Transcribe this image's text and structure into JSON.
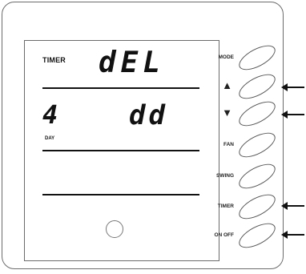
{
  "display": {
    "timer_label": "TIMER",
    "main_readout": "dEL",
    "left_readout": "4",
    "right_readout": "dd",
    "day_label": "DAY"
  },
  "buttons": [
    {
      "id": "mode",
      "label": "MODE",
      "indicated": false
    },
    {
      "id": "up",
      "label": "▲",
      "indicated": true
    },
    {
      "id": "down",
      "label": "▼",
      "indicated": true
    },
    {
      "id": "fan",
      "label": "FAN",
      "indicated": false
    },
    {
      "id": "swing",
      "label": "SWING",
      "indicated": false
    },
    {
      "id": "timer",
      "label": "TIMER",
      "indicated": true
    },
    {
      "id": "on-off",
      "label": "ON OFF",
      "indicated": true
    }
  ]
}
